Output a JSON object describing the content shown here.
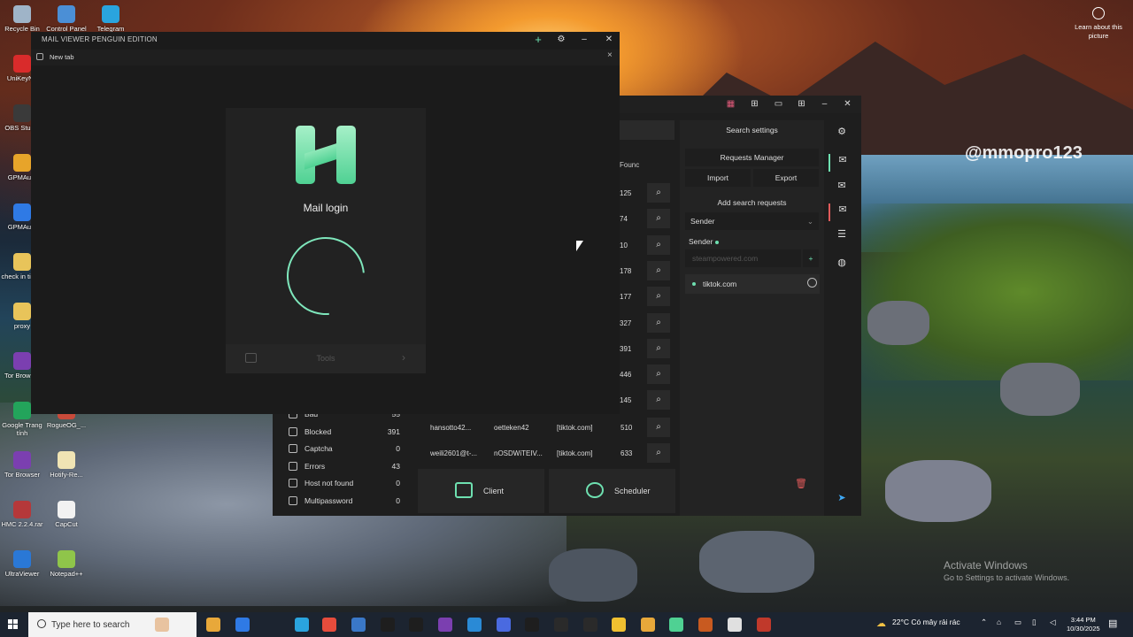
{
  "desktop": {
    "icons": [
      {
        "label": "Recycle Bin",
        "color": "#9fb4c8"
      },
      {
        "label": "Control Panel",
        "color": "#4b8fd6"
      },
      {
        "label": "Telegram",
        "color": "#2aa4de"
      },
      {
        "label": "UniKeyNT",
        "color": "#d92b2b"
      },
      {
        "label": "OBS Studio",
        "color": "#3a3a3a"
      },
      {
        "label": "GPMAuto",
        "color": "#e7a42a"
      },
      {
        "label": "GPMAuto",
        "color": "#2f7ae5"
      },
      {
        "label": "check in tiktok",
        "color": "#e8c45a"
      },
      {
        "label": "proxy",
        "color": "#e8c45a"
      },
      {
        "label": "Tor Browser",
        "color": "#7b3fb0"
      },
      {
        "label": "Google Trang tính",
        "color": "#23a45b"
      },
      {
        "label": "RogueOG_...",
        "color": "#c84a3a"
      },
      {
        "label": "Tor Browser",
        "color": "#7b3fb0"
      },
      {
        "label": "Hotify-Re...",
        "color": "#f0e4b4"
      },
      {
        "label": "HMC 2.2.4.rar",
        "color": "#b5383a"
      },
      {
        "label": "CapCut",
        "color": "#f2f2f2"
      },
      {
        "label": "UltraViewer",
        "color": "#2a78d6"
      },
      {
        "label": "Notepad++",
        "color": "#8fc54a"
      }
    ],
    "learn_more": "Learn about this picture",
    "watermark": "@mmopro123",
    "activate_title": "Activate Windows",
    "activate_sub": "Go to Settings to activate Windows."
  },
  "mail_viewer": {
    "title": "MAIL VIEWER PENGUIN EDITION",
    "tab_label": "New tab",
    "login_text": "Mail login",
    "tools_label": "Tools",
    "accent": "#6ee0b0"
  },
  "background_app": {
    "found_header": "Founc",
    "found_numbers": [
      "125",
      "74",
      "10",
      "178",
      "177",
      "327",
      "391",
      "446",
      "145"
    ],
    "stats": [
      {
        "label": "Bad",
        "value": "55"
      },
      {
        "label": "Blocked",
        "value": "391"
      },
      {
        "label": "Captcha",
        "value": "0"
      },
      {
        "label": "Errors",
        "value": "43"
      },
      {
        "label": "Host not found",
        "value": "0"
      },
      {
        "label": "Multipassword",
        "value": "0"
      }
    ],
    "rows": [
      {
        "user": "hansotto42...",
        "pass": "oetteken42",
        "req": "[tiktok.com]",
        "count": "510"
      },
      {
        "user": "weili2601@t-...",
        "pass": "nOSDWiTEIV...",
        "req": "[tiktok.com]",
        "count": "633"
      }
    ],
    "client_label": "Client",
    "scheduler_label": "Scheduler",
    "search_settings": "Search settings",
    "requests_manager": "Requests Manager",
    "import_label": "Import",
    "export_label": "Export",
    "add_search_requests": "Add search requests",
    "sender_select": "Sender",
    "sender_label": "Sender",
    "sender_placeholder": "steampowered.com",
    "sender_add": "+",
    "request_item": "tiktok.com"
  },
  "taskbar": {
    "search_placeholder": "Type here to search",
    "weather": "22°C  Có mây rải rác",
    "time": "3:44 PM",
    "date": "10/30/2025"
  }
}
